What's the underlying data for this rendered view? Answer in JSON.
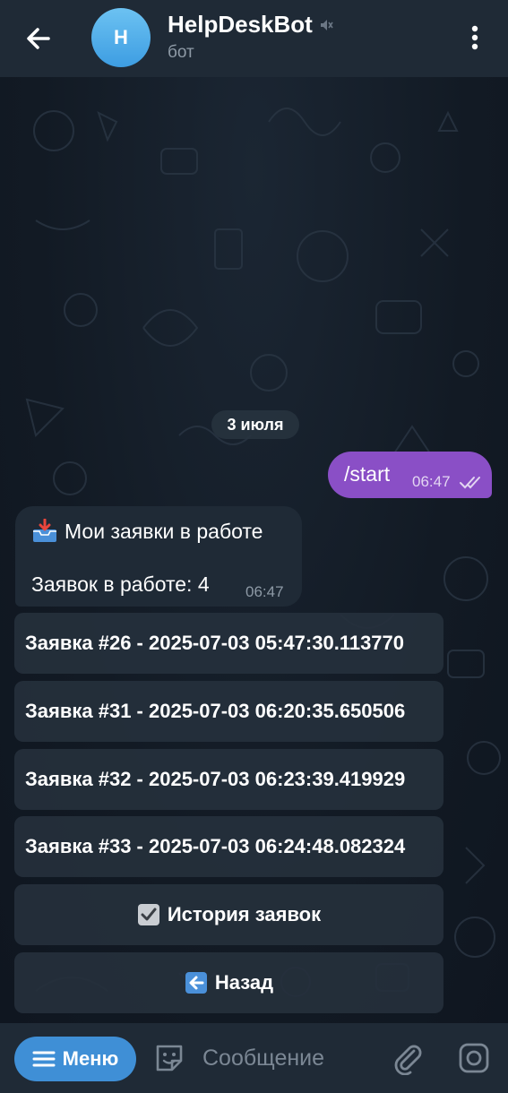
{
  "header": {
    "avatar_letter": "H",
    "title": "HelpDeskBot",
    "subtitle": "бот"
  },
  "chat": {
    "date_chip": "3 июля",
    "outgoing": {
      "text": "/start",
      "time": "06:47"
    },
    "incoming": {
      "line1": "Мои заявки в работе",
      "line2": "Заявок в работе: 4",
      "time": "06:47"
    },
    "inline_keyboard": [
      {
        "label": "Заявка #26 - 2025-07-03 05:47:30.113770"
      },
      {
        "label": "Заявка #31 - 2025-07-03 06:20:35.650506"
      },
      {
        "label": "Заявка #32 - 2025-07-03 06:23:39.419929"
      },
      {
        "label": "Заявка #33 - 2025-07-03 06:24:48.082324"
      },
      {
        "label": "История заявок",
        "icon": "check-icon"
      },
      {
        "label": "Назад",
        "icon": "back-arrow-icon"
      }
    ]
  },
  "composer": {
    "menu_label": "Меню",
    "placeholder": "Сообщение"
  },
  "colors": {
    "header_bg": "#1f2a36",
    "chat_bg": "#121a24",
    "outgoing_bubble": "#8a4fc6",
    "menu_button": "#3f8fd6"
  }
}
